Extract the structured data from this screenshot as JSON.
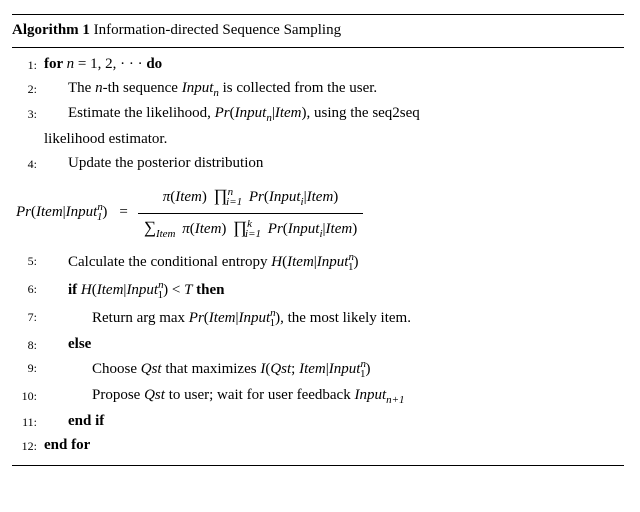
{
  "title_prefix": "Algorithm 1",
  "title_text": " Information-directed Sequence Sampling",
  "lines": {
    "l1a": "for ",
    "l1b": "n",
    "l1c": " = 1, 2, · · · ",
    "l1d": "do",
    "l2a": "The ",
    "l2b": "n",
    "l2c": "-th sequence ",
    "l2d": "Input",
    "l2dn": "n",
    "l2e": " is collected from the user.",
    "l3a": "Estimate the likelihood, ",
    "l3b": "Pr",
    "l3c": "(",
    "l3d": "Input",
    "l3dn": "n",
    "l3e": "|",
    "l3f": "Item",
    "l3g": ")",
    "l3h": ", using the seq2seq",
    "l3cont": "likelihood estimator.",
    "l4": "Update the posterior distribution",
    "f_lhs_pr": "Pr",
    "f_lhs_open": "(",
    "f_lhs_item": "Item",
    "f_lhs_bar": "|",
    "f_lhs_input": "Input",
    "f_lhs_close": ")",
    "f_eq": "=",
    "f_top_pi": "π",
    "f_top_open": "(",
    "f_top_item": "Item",
    "f_top_close": ")",
    "f_top_prod": "∏",
    "f_top_pr": "Pr",
    "f_top_input": "Input",
    "f_bot_sum": "∑",
    "f_bot_sub": "Item",
    "f_pi": "π",
    "n_sup": "n",
    "one_sub": "1",
    "i_eq_1": "i=1",
    "i_sub": "i",
    "k_sup": "k",
    "Item": "Item",
    "Input": "Input",
    "l5a": "Calculate the conditional entropy ",
    "H": "H",
    "l6a": "if ",
    "l6lt": " < ",
    "l6T": "T",
    "l6then": " then",
    "l7a": "Return arg max ",
    "l7b": ", the most likely item.",
    "l8": "else",
    "l9a": "Choose ",
    "Qst": "Qst",
    "l9b": " that maximizes ",
    "Iletter": "I",
    "l9semi": ";",
    "l10a": "Propose ",
    "l10b": " to user; wait for user feedback ",
    "np1": "n+1",
    "l11": "end if",
    "l12": "end for"
  },
  "linenos": {
    "n1": "1:",
    "n2": "2:",
    "n3": "3:",
    "n4": "4:",
    "n5": "5:",
    "n6": "6:",
    "n7": "7:",
    "n8": "8:",
    "n9": "9:",
    "n10": "10:",
    "n11": "11:",
    "n12": "12:"
  }
}
